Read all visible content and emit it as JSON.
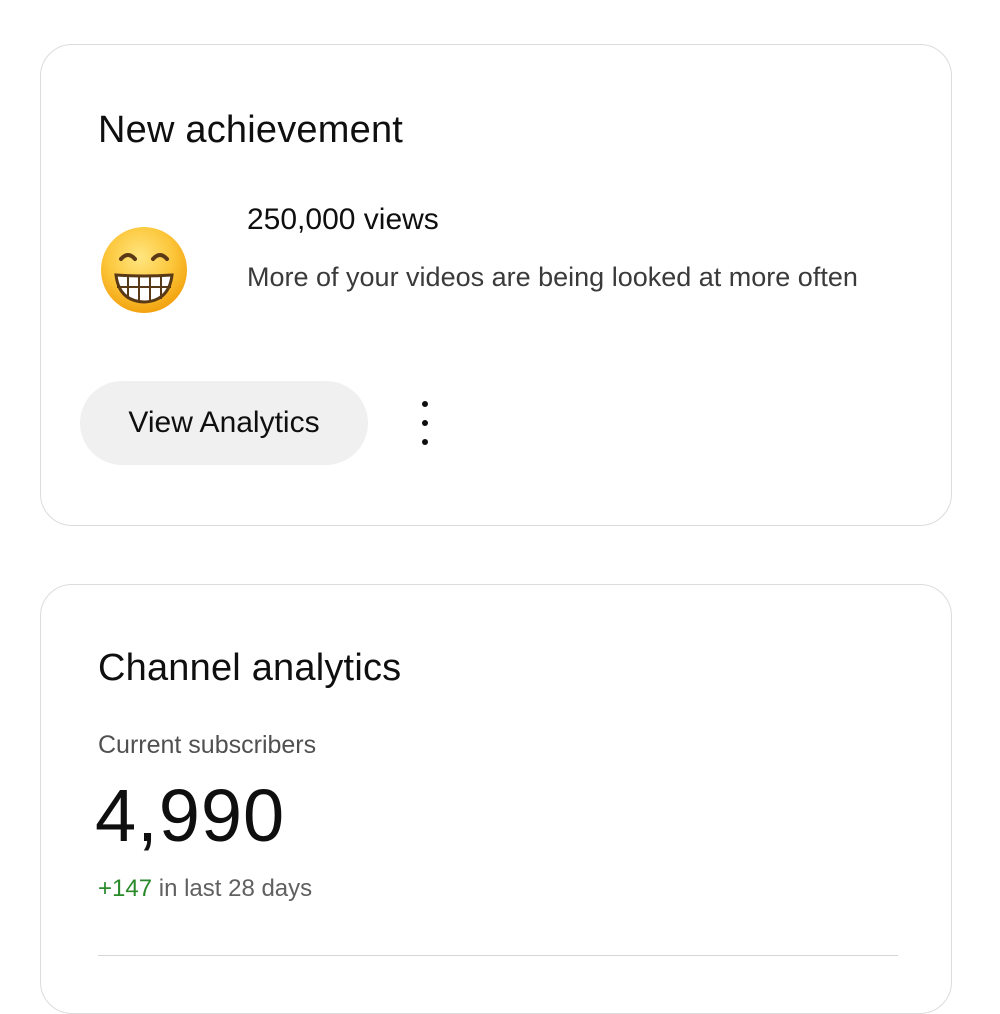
{
  "achievement_card": {
    "title": "New achievement",
    "icon": "grinning-face-emoji",
    "headline": "250,000 views",
    "description": "More of your videos are being looked at more often",
    "primary_button_label": "View Analytics",
    "more_icon": "more-vert-icon"
  },
  "analytics_card": {
    "title": "Channel analytics",
    "subscribers_label": "Current subscribers",
    "subscribers_count": "4,990",
    "change_value": "+147",
    "change_period": "in last 28 days"
  },
  "colors": {
    "positive_change": "#2a8a2a",
    "button_bg": "#f0f0f0",
    "card_border": "#dcdcdc"
  }
}
